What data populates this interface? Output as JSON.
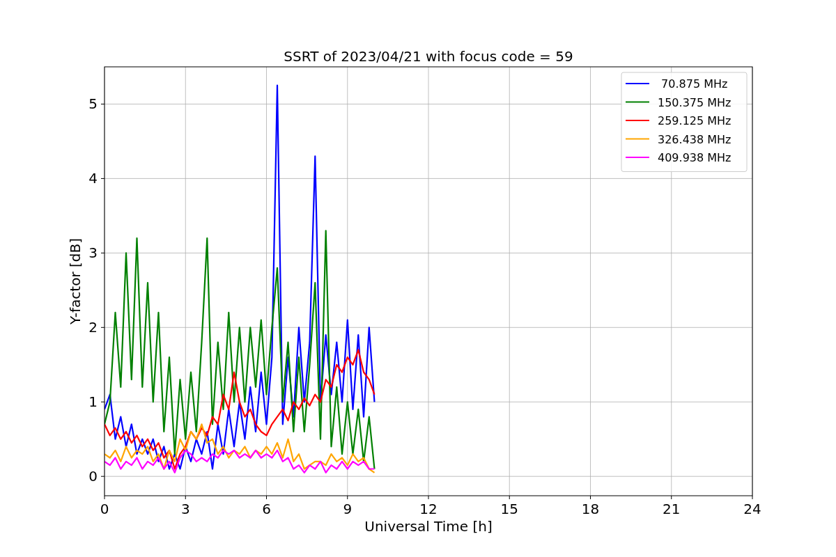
{
  "figure": {
    "chart_data": {
      "type": "line",
      "title": "SSRT of 2023/04/21 with focus code = 59",
      "xlabel": "Universal Time [h]",
      "ylabel": "Y-factor [dB]",
      "x": [
        0,
        0.2,
        0.4,
        0.6,
        0.8,
        1,
        1.2,
        1.4,
        1.6,
        1.8,
        2,
        2.2,
        2.4,
        2.6,
        2.8,
        3,
        3.2,
        3.4,
        3.6,
        3.8,
        4,
        4.2,
        4.4,
        4.6,
        4.8,
        5,
        5.2,
        5.4,
        5.6,
        5.8,
        6,
        6.2,
        6.4,
        6.6,
        6.8,
        7,
        7.2,
        7.4,
        7.6,
        7.8,
        8,
        8.2,
        8.4,
        8.6,
        8.8,
        9,
        9.2,
        9.4,
        9.6,
        9.8,
        10
      ],
      "series": [
        {
          "name": " 70.875 MHz",
          "color": "#0000ff",
          "values": [
            0.9,
            1.1,
            0.5,
            0.8,
            0.4,
            0.7,
            0.3,
            0.5,
            0.3,
            0.5,
            0.2,
            0.4,
            0.1,
            0.3,
            0.1,
            0.4,
            0.2,
            0.5,
            0.3,
            0.6,
            0.1,
            0.7,
            0.3,
            0.9,
            0.4,
            1.0,
            0.5,
            1.2,
            0.6,
            1.4,
            0.7,
            1.6,
            5.25,
            0.7,
            1.6,
            0.8,
            2.0,
            1.0,
            1.8,
            4.3,
            1.0,
            1.9,
            1.1,
            1.8,
            1.0,
            2.1,
            0.9,
            1.9,
            0.8,
            2.0,
            1.0
          ]
        },
        {
          "name": "150.375 MHz",
          "color": "#008000",
          "values": [
            0.7,
            1.0,
            2.2,
            1.2,
            3.0,
            1.3,
            3.2,
            1.2,
            2.6,
            1.0,
            2.2,
            0.6,
            1.6,
            0.3,
            1.3,
            0.5,
            1.4,
            0.6,
            1.8,
            3.2,
            0.7,
            1.8,
            0.9,
            2.2,
            1.0,
            2.0,
            1.0,
            2.0,
            1.2,
            2.1,
            1.1,
            2.0,
            2.8,
            1.0,
            1.8,
            0.6,
            1.6,
            0.6,
            1.5,
            2.6,
            0.5,
            3.3,
            0.4,
            1.2,
            0.3,
            1.0,
            0.3,
            0.9,
            0.2,
            0.8,
            0.1
          ]
        },
        {
          "name": "259.125 MHz",
          "color": "#ff0000",
          "values": [
            0.7,
            0.55,
            0.65,
            0.5,
            0.6,
            0.45,
            0.55,
            0.4,
            0.5,
            0.35,
            0.45,
            0.25,
            0.35,
            0.1,
            0.3,
            0.4,
            0.6,
            0.5,
            0.65,
            0.55,
            0.8,
            0.7,
            1.1,
            0.9,
            1.4,
            1.0,
            0.8,
            0.9,
            0.7,
            0.6,
            0.55,
            0.7,
            0.8,
            0.9,
            0.75,
            1.0,
            0.9,
            1.05,
            0.95,
            1.1,
            1.0,
            1.3,
            1.2,
            1.5,
            1.4,
            1.6,
            1.5,
            1.7,
            1.4,
            1.3,
            1.1
          ]
        },
        {
          "name": "326.438 MHz",
          "color": "#ffa500",
          "values": [
            0.3,
            0.25,
            0.35,
            0.2,
            0.4,
            0.25,
            0.35,
            0.3,
            0.4,
            0.2,
            0.3,
            0.1,
            0.35,
            0.2,
            0.5,
            0.35,
            0.6,
            0.5,
            0.7,
            0.45,
            0.5,
            0.3,
            0.4,
            0.25,
            0.35,
            0.3,
            0.4,
            0.25,
            0.35,
            0.3,
            0.4,
            0.3,
            0.45,
            0.25,
            0.5,
            0.2,
            0.3,
            0.1,
            0.15,
            0.2,
            0.2,
            0.15,
            0.3,
            0.2,
            0.25,
            0.15,
            0.3,
            0.2,
            0.25,
            0.1,
            0.05
          ]
        },
        {
          "name": "409.938 MHz",
          "color": "#ff00ff",
          "values": [
            0.2,
            0.15,
            0.25,
            0.1,
            0.2,
            0.15,
            0.25,
            0.1,
            0.2,
            0.15,
            0.25,
            0.1,
            0.2,
            0.05,
            0.25,
            0.35,
            0.3,
            0.2,
            0.25,
            0.2,
            0.3,
            0.25,
            0.35,
            0.3,
            0.35,
            0.25,
            0.3,
            0.25,
            0.35,
            0.25,
            0.3,
            0.25,
            0.35,
            0.2,
            0.25,
            0.1,
            0.15,
            0.05,
            0.15,
            0.1,
            0.2,
            0.05,
            0.15,
            0.1,
            0.2,
            0.1,
            0.2,
            0.15,
            0.2,
            0.1,
            0.1
          ]
        }
      ],
      "grid": true,
      "legend": true,
      "xlim": [
        0,
        24
      ],
      "ylim": [
        -0.26,
        5.5
      ],
      "xticks": [
        0,
        3,
        6,
        9,
        12,
        15,
        18,
        21,
        24
      ],
      "yticks": [
        0,
        1,
        2,
        3,
        4,
        5
      ]
    }
  }
}
